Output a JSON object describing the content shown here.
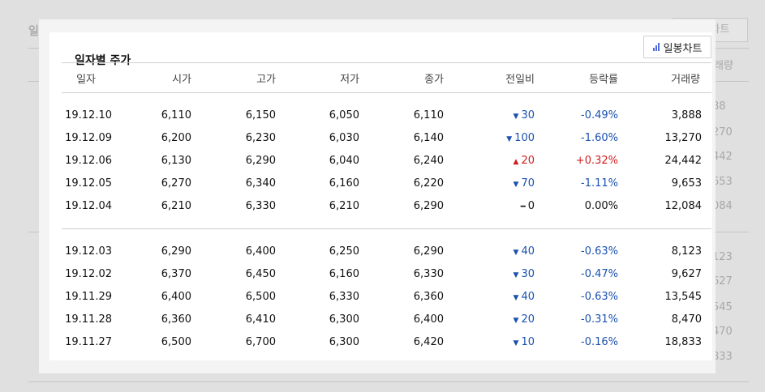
{
  "background": {
    "title": "일자별 주가",
    "chart_button": "일봉차트",
    "left_col_fragments": [
      "일",
      "19",
      "19",
      "19",
      "19",
      "19",
      "19",
      "19",
      "19",
      "19",
      "19"
    ],
    "right_col_fragments": [
      "래량",
      "88",
      "270",
      "442",
      "653",
      "084",
      "123",
      "627",
      "545",
      "470",
      "833"
    ]
  },
  "modal": {
    "title": "일자별 주가",
    "chart_button": "일봉차트",
    "headers": [
      "일자",
      "시가",
      "고가",
      "저가",
      "종가",
      "전일비",
      "등락률",
      "거래량"
    ],
    "groups": [
      [
        {
          "date": "19.12.10",
          "open": "6,110",
          "high": "6,150",
          "low": "6,050",
          "close": "6,110",
          "dir": "down",
          "diff": "30",
          "rate": "-0.49%",
          "volume": "3,888"
        },
        {
          "date": "19.12.09",
          "open": "6,200",
          "high": "6,230",
          "low": "6,030",
          "close": "6,140",
          "dir": "down",
          "diff": "100",
          "rate": "-1.60%",
          "volume": "13,270"
        },
        {
          "date": "19.12.06",
          "open": "6,130",
          "high": "6,290",
          "low": "6,040",
          "close": "6,240",
          "dir": "up",
          "diff": "20",
          "rate": "+0.32%",
          "volume": "24,442"
        },
        {
          "date": "19.12.05",
          "open": "6,270",
          "high": "6,340",
          "low": "6,160",
          "close": "6,220",
          "dir": "down",
          "diff": "70",
          "rate": "-1.11%",
          "volume": "9,653"
        },
        {
          "date": "19.12.04",
          "open": "6,210",
          "high": "6,330",
          "low": "6,210",
          "close": "6,290",
          "dir": "flat",
          "diff": "0",
          "rate": "0.00%",
          "volume": "12,084"
        }
      ],
      [
        {
          "date": "19.12.03",
          "open": "6,290",
          "high": "6,400",
          "low": "6,250",
          "close": "6,290",
          "dir": "down",
          "diff": "40",
          "rate": "-0.63%",
          "volume": "8,123"
        },
        {
          "date": "19.12.02",
          "open": "6,370",
          "high": "6,450",
          "low": "6,160",
          "close": "6,330",
          "dir": "down",
          "diff": "30",
          "rate": "-0.47%",
          "volume": "9,627"
        },
        {
          "date": "19.11.29",
          "open": "6,400",
          "high": "6,500",
          "low": "6,330",
          "close": "6,360",
          "dir": "down",
          "diff": "40",
          "rate": "-0.63%",
          "volume": "13,545"
        },
        {
          "date": "19.11.28",
          "open": "6,360",
          "high": "6,410",
          "low": "6,300",
          "close": "6,400",
          "dir": "down",
          "diff": "20",
          "rate": "-0.31%",
          "volume": "8,470"
        },
        {
          "date": "19.11.27",
          "open": "6,500",
          "high": "6,700",
          "low": "6,300",
          "close": "6,420",
          "dir": "down",
          "diff": "10",
          "rate": "-0.16%",
          "volume": "18,833"
        }
      ]
    ]
  },
  "colors": {
    "down": "#1a50b0",
    "up": "#d01c1c",
    "flat": "#111111"
  }
}
